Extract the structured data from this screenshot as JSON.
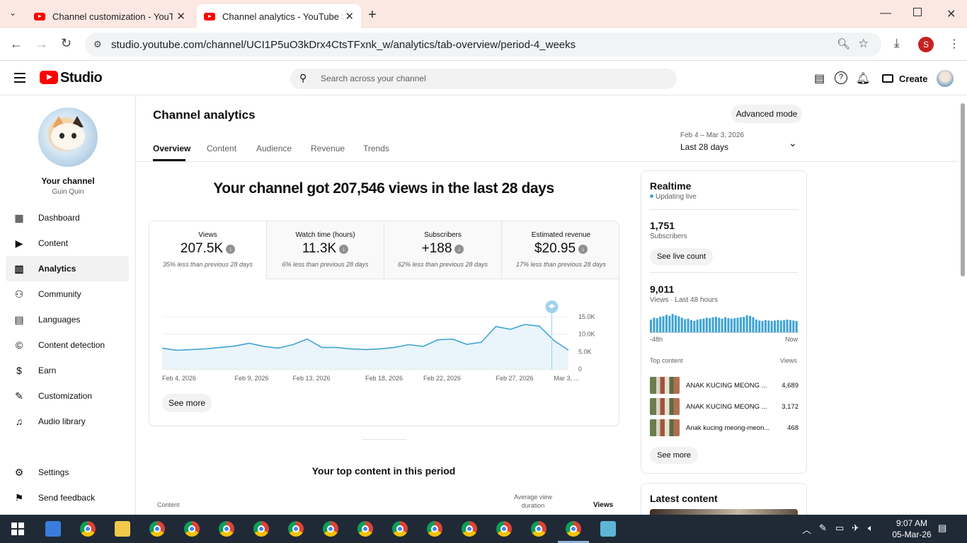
{
  "browser": {
    "tabs": [
      {
        "title": "Channel customization - YouTube Studio"
      },
      {
        "title": "Channel analytics - YouTube Studio"
      }
    ],
    "url": "studio.youtube.com/channel/UCI1P5uO3kDrx4CtsTFxnk_w/analytics/tab-overview/period-4_weeks",
    "profile_initial": "S"
  },
  "header": {
    "logo_text": "Studio",
    "search_placeholder": "Search across your channel",
    "create_label": "Create"
  },
  "sidebar": {
    "your_channel": "Your channel",
    "channel_name": "Guin Quin",
    "items": [
      {
        "label": "Dashboard",
        "icon": "dashboard-icon"
      },
      {
        "label": "Content",
        "icon": "content-icon"
      },
      {
        "label": "Analytics",
        "icon": "analytics-icon"
      },
      {
        "label": "Community",
        "icon": "community-icon"
      },
      {
        "label": "Languages",
        "icon": "languages-icon"
      },
      {
        "label": "Content detection",
        "icon": "copyright-icon"
      },
      {
        "label": "Earn",
        "icon": "dollar-icon"
      },
      {
        "label": "Customization",
        "icon": "magic-wand-icon"
      },
      {
        "label": "Audio library",
        "icon": "audio-library-icon"
      }
    ],
    "settings": "Settings",
    "feedback": "Send feedback"
  },
  "main": {
    "title": "Channel analytics",
    "advanced_mode": "Advanced mode",
    "tabs": [
      "Overview",
      "Content",
      "Audience",
      "Revenue",
      "Trends"
    ],
    "date_range": "Feb 4 – Mar 3, 2026",
    "date_label": "Last 28 days",
    "headline": "Your channel got 207,546 views in the last 28 days",
    "metrics": [
      {
        "label": "Views",
        "value": "207.5K",
        "comparison": "35% less than previous 28 days"
      },
      {
        "label": "Watch time (hours)",
        "value": "11.3K",
        "comparison": "6% less than previous 28 days"
      },
      {
        "label": "Subscribers",
        "value": "+188",
        "comparison": "62% less than previous 28 days"
      },
      {
        "label": "Estimated revenue",
        "value": "$20.95",
        "comparison": "17% less than previous 28 days"
      }
    ],
    "see_more": "See more",
    "top_content_title": "Your top content in this period",
    "col_content": "Content",
    "col_avg_line1": "Average view",
    "col_avg_line2": "duration",
    "col_views": "Views"
  },
  "chart_data": {
    "type": "area",
    "x_tick_labels": [
      "Feb 4, 2026",
      "Feb 9, 2026",
      "Feb 13, 2026",
      "Feb 18, 2026",
      "Feb 22, 2026",
      "Feb 27, 2026",
      "Mar 3, ..."
    ],
    "y_tick_labels": [
      "15.0K",
      "10.0K",
      "5.0K",
      "0"
    ],
    "ylim": [
      0,
      15000
    ],
    "x": [
      "Feb 4",
      "Feb 5",
      "Feb 6",
      "Feb 7",
      "Feb 8",
      "Feb 9",
      "Feb 10",
      "Feb 11",
      "Feb 12",
      "Feb 13",
      "Feb 14",
      "Feb 15",
      "Feb 16",
      "Feb 17",
      "Feb 18",
      "Feb 19",
      "Feb 20",
      "Feb 21",
      "Feb 22",
      "Feb 23",
      "Feb 24",
      "Feb 25",
      "Feb 26",
      "Feb 27",
      "Feb 28",
      "Mar 1",
      "Mar 2",
      "Mar 3",
      "Mar 3b"
    ],
    "values": [
      6000,
      5400,
      5600,
      5800,
      6200,
      6600,
      7400,
      6500,
      6000,
      7000,
      8600,
      6200,
      6200,
      5800,
      5600,
      5800,
      6200,
      7000,
      6500,
      8400,
      8600,
      7100,
      7700,
      12200,
      11400,
      12800,
      12300,
      8200,
      5400
    ],
    "grid": true,
    "marker": "graduation-cap-icon"
  },
  "realtime": {
    "title": "Realtime",
    "status": "Updating live",
    "subscribers": "1,751",
    "subscribers_label": "Subscribers",
    "see_live": "See live count",
    "views": "9,011",
    "views_label": "Views · Last 48 hours",
    "bar_start": "-48h",
    "bar_end": "Now",
    "bars": [
      180,
      220,
      210,
      240,
      250,
      280,
      260,
      300,
      270,
      250,
      220,
      190,
      200,
      170,
      150,
      180,
      190,
      200,
      220,
      210,
      230,
      240,
      220,
      200,
      230,
      210,
      200,
      210,
      220,
      230,
      240,
      270,
      260,
      230,
      180,
      160,
      150,
      170,
      160,
      150,
      160,
      170,
      160,
      170,
      180,
      170,
      160,
      150
    ],
    "top_content_label": "Top content",
    "top_views_label": "Views",
    "top": [
      {
        "title": "ANAK KUCING MEONG ...",
        "views": "4,689"
      },
      {
        "title": "ANAK KUCING MEONG ...",
        "views": "3,172"
      },
      {
        "title": "Anak kucing meong-meon...",
        "views": "468"
      }
    ],
    "see_more": "See more"
  },
  "latest": {
    "title": "Latest content"
  },
  "taskbar": {
    "time": "9:07 AM",
    "date": "05-Mar-26"
  },
  "colors": {
    "accent": "#41a4d3",
    "area_fill": "#e9f5fb",
    "brand": "#ff0000"
  }
}
